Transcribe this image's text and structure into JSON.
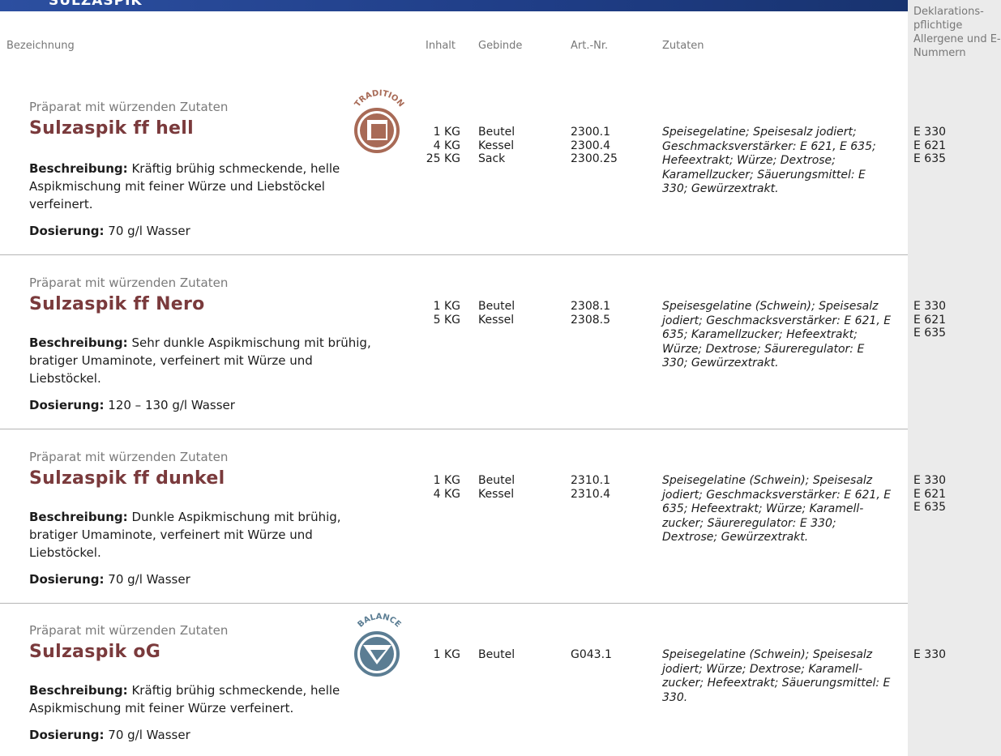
{
  "header_title": "SULZASPIK",
  "columns": {
    "bezeichnung": "Bezeichnung",
    "inhalt": "Inhalt",
    "gebinde": "Gebinde",
    "artnr": "Art.-Nr.",
    "zutaten": "Zutaten",
    "allergene": "Deklarations-pflichtige Allergene und E-Nummern"
  },
  "products": [
    {
      "prefix": "Präparat mit würzenden Zutaten",
      "name": "Sulzaspik ff hell",
      "badge": "TRADITION",
      "description_label": "Beschreibung:",
      "description": "Kräftig brühig schmeckende, helle Aspikmischung mit feiner Würze und Liebstöckel verfeinert.",
      "dosage_label": "Dosierung:",
      "dosage": "70 g/l Wasser",
      "inhalt": [
        "1 KG",
        "4 KG",
        "25 KG"
      ],
      "gebinde": [
        "Beutel",
        "Kessel",
        "Sack"
      ],
      "artnr": [
        "2300.1",
        "2300.4",
        "2300.25"
      ],
      "ingredients": "Speisegelatine; Speisesalz jodiert; Geschmacksverstärker: E 621, E 635; Hefeextrakt; Würze; Dextrose; Karamellzucker; Säuerungsmittel: E 330; Gewürzextrakt.",
      "allergens": [
        "E 330",
        "E 621",
        "E 635"
      ]
    },
    {
      "prefix": "Präparat mit würzenden Zutaten",
      "name": "Sulzaspik ff Nero",
      "description_label": "Beschreibung:",
      "description": "Sehr dunkle Aspikmischung mit brühig, bratiger Umaminote, verfeinert mit Würze und Liebstöckel.",
      "dosage_label": "Dosierung:",
      "dosage": "120 – 130 g/l Wasser",
      "inhalt": [
        "1 KG",
        "5 KG"
      ],
      "gebinde": [
        "Beutel",
        "Kessel"
      ],
      "artnr": [
        "2308.1",
        "2308.5"
      ],
      "ingredients": "Speisesgelatine (Schwein); Speisesalz jodiert; Geschmacksverstärker: E 621, E 635; Karamellzucker; Hefeextrakt; Würze; Dextrose; Säureregulator: E 330; Gewürzextrakt.",
      "allergens": [
        "E 330",
        "E 621",
        "E 635"
      ]
    },
    {
      "prefix": "Präparat mit würzenden Zutaten",
      "name": "Sulzaspik ff dunkel",
      "description_label": "Beschreibung:",
      "description": "Dunkle Aspikmischung mit brühig, bratiger Umaminote, verfeinert mit Würze und Liebstöckel.",
      "dosage_label": "Dosierung:",
      "dosage": "70 g/l Wasser",
      "inhalt": [
        "1 KG",
        "4 KG"
      ],
      "gebinde": [
        "Beutel",
        "Kessel"
      ],
      "artnr": [
        "2310.1",
        "2310.4"
      ],
      "ingredients": "Speisegelatine (Schwein); Speisesalz jodiert; Geschmacksverstärker: E 621, E 635; Hefeextrakt; Würze; Karamell-zucker; Säureregulator: E 330; Dextrose; Gewürzextrakt.",
      "allergens": [
        "E 330",
        "E 621",
        "E 635"
      ]
    },
    {
      "prefix": "Präparat mit würzenden Zutaten",
      "name": "Sulzaspik oG",
      "badge": "BALANCE",
      "description_label": "Beschreibung:",
      "description": "Kräftig brühig schmeckende, helle Aspikmischung mit feiner Würze verfeinert.",
      "dosage_label": "Dosierung:",
      "dosage": "70 g/l Wasser",
      "inhalt": [
        "1 KG"
      ],
      "gebinde": [
        "Beutel"
      ],
      "artnr": [
        "G043.1"
      ],
      "ingredients": "Speisegelatine (Schwein); Speisesalz jodiert; Würze; Dextrose; Karamell-zucker; Hefeextrakt; Säuerungsmittel: E 330.",
      "allergens": [
        "E 330"
      ]
    }
  ],
  "colors": {
    "name": "#7a3a3c",
    "tradition": "#a86a56",
    "balance": "#5b7d93",
    "header": "#2c4fa0"
  }
}
